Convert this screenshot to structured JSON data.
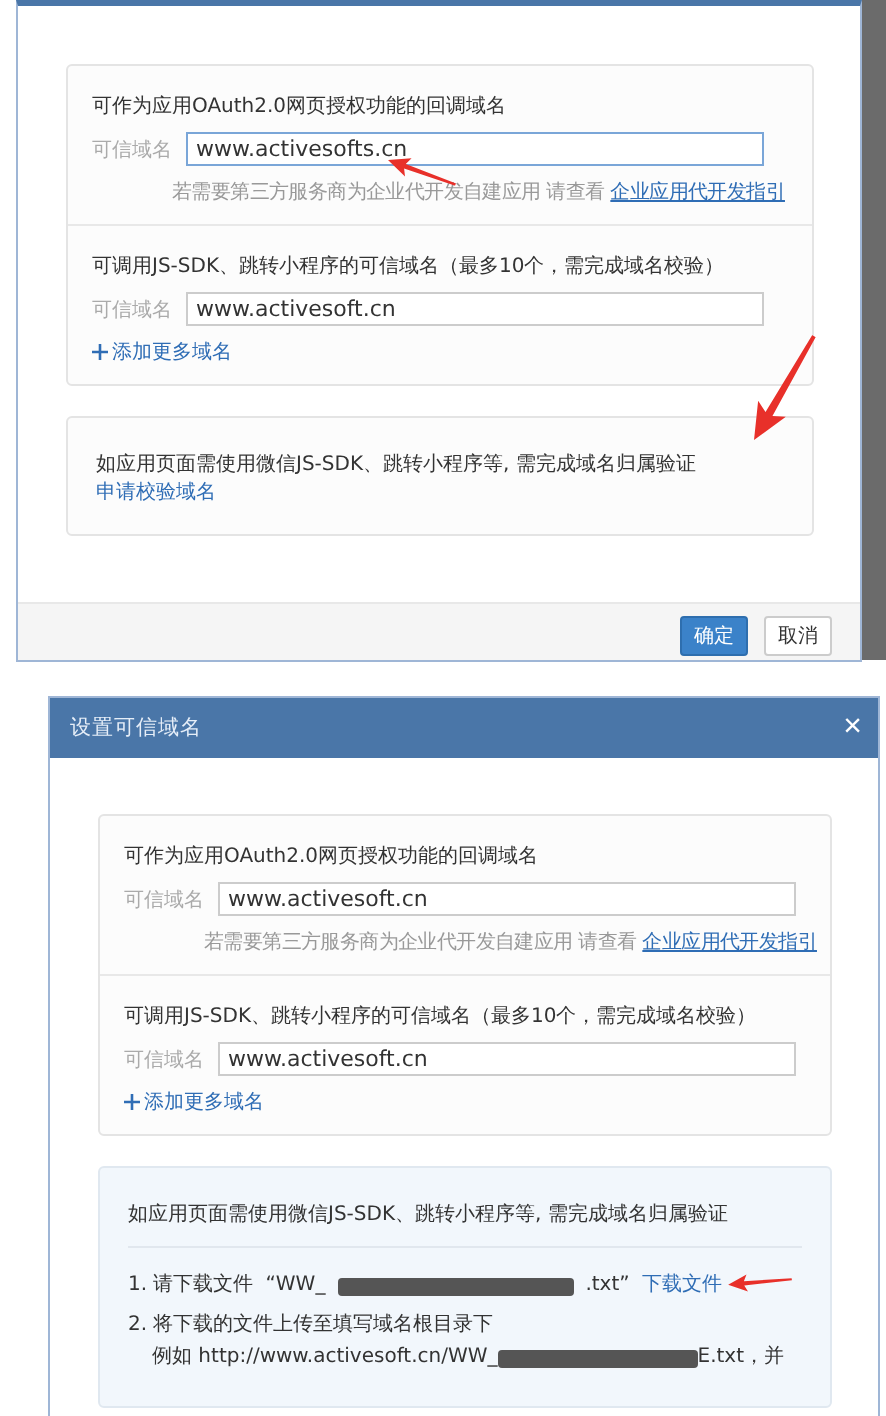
{
  "top_dialog": {
    "callback_section": {
      "heading": "可作为应用OAuth2.0网页授权功能的回调域名",
      "label": "可信域名",
      "value": "www.activesofts.cn",
      "hint": "若需要第三方服务商为企业代开发自建应用 请查看",
      "hint_link": "企业应用代开发指引"
    },
    "jssdk_section": {
      "heading": "可调用JS-SDK、跳转小程序的可信域名（最多10个，需完成域名校验）",
      "label": "可信域名",
      "value": "www.activesoft.cn",
      "add_link": "添加更多域名"
    },
    "verify_section": {
      "text": "如应用页面需使用微信JS-SDK、跳转小程序等, 需完成域名归属验证",
      "link": "申请校验域名"
    },
    "buttons": [
      {
        "label": "确定",
        "kind": "primary"
      },
      {
        "label": "取消",
        "kind": "default"
      }
    ]
  },
  "bottom_dialog": {
    "title": "设置可信域名",
    "close": "×",
    "callback_section": {
      "heading": "可作为应用OAuth2.0网页授权功能的回调域名",
      "label": "可信域名",
      "value": "www.activesoft.cn",
      "hint": "若需要第三方服务商为企业代开发自建应用 请查看",
      "hint_link": "企业应用代开发指引"
    },
    "jssdk_section": {
      "heading": "可调用JS-SDK、跳转小程序的可信域名（最多10个，需完成域名校验）",
      "label": "可信域名",
      "value": "www.activesoft.cn",
      "add_link": "添加更多域名"
    },
    "verify_section": {
      "text": "如应用页面需使用微信JS-SDK、跳转小程序等, 需完成域名归属验证",
      "step_1": {
        "text": "1. 请下载文件",
        "file_prefix": "“WW_",
        "file_suffix": ".txt”",
        "link": "下载文件"
      },
      "step_2": {
        "text": "2. 将下载的文件上传至填写域名根目录下",
        "example_prefix": "例如 http://www.activesoft.cn/WW_",
        "example_suffix": "E.txt，并"
      }
    }
  }
}
